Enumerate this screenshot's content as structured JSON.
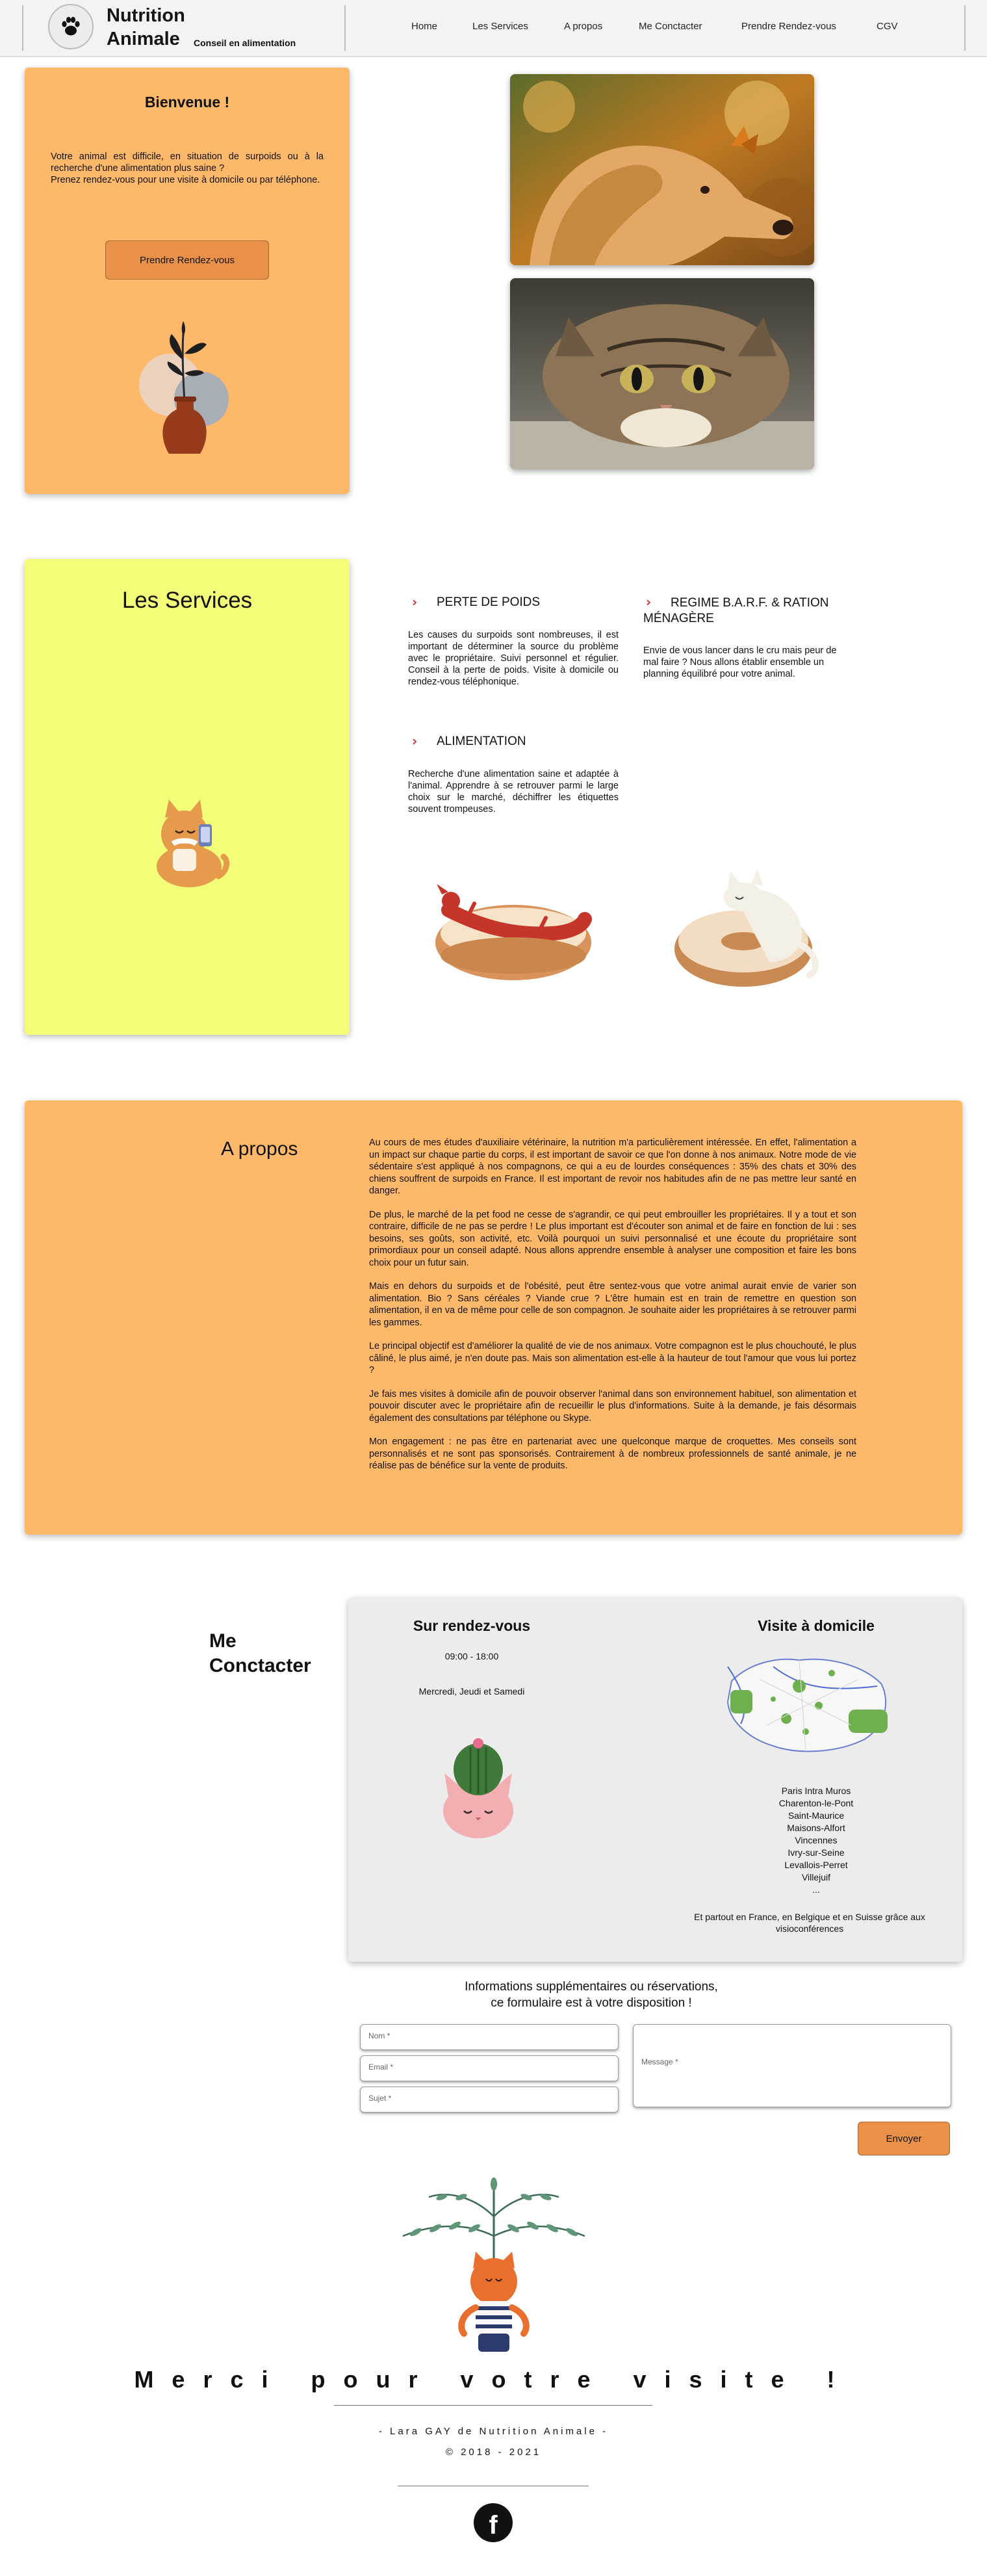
{
  "header": {
    "brand_line1": "Nutrition",
    "brand_line2": "Animale",
    "tagline": "Conseil en alimentation",
    "nav": [
      "Home",
      "Les Services",
      "A propos",
      "Me Conctacter",
      "Prendre Rendez-vous",
      "CGV"
    ]
  },
  "welcome": {
    "title": "Bienvenue !",
    "text": "Votre animal est difficile, en situation de surpoids ou à la recherche d'une alimentation plus saine ?\nPrenez rendez-vous pour une visite à domicile ou par téléphone.",
    "button": "Prendre Rendez-vous"
  },
  "services": {
    "title": "Les Services",
    "items": [
      {
        "title": "PERTE DE POIDS",
        "text": "Les causes du surpoids sont nombreuses, il est important de déterminer la source du problème avec le propriétaire. Suivi personnel et régulier. Conseil à la perte de poids. Visite à domicile ou rendez-vous téléphonique."
      },
      {
        "title": "REGIME B.A.R.F. & RATION MÉNAGÈRE",
        "text": "Envie de vous lancer dans le cru mais peur de mal faire ? Nous allons établir ensemble un planning équilibré pour votre animal."
      },
      {
        "title": "ALIMENTATION",
        "text": "Recherche d'une alimentation saine et adaptée à l'animal. Apprendre à se retrouver parmi le large choix sur le marché, déchiffrer les étiquettes souvent trompeuses."
      }
    ]
  },
  "apropos": {
    "title": "A propos",
    "paragraphs": [
      "Au cours de mes études d'auxiliaire vétérinaire, la nutrition m'a particulièrement intéressée. En effet, l'alimentation a un impact sur chaque partie du corps, il est important de savoir ce que l'on donne à nos animaux. Notre mode de vie sédentaire s'est appliqué à nos compagnons, ce qui a eu de lourdes conséquences : 35% des chats et 30% des chiens souffrent de surpoids en France. Il est important de revoir nos habitudes afin de ne pas mettre leur santé en danger.",
      "De plus, le marché de la pet food ne cesse de s'agrandir, ce qui peut embrouiller les propriétaires. Il y a tout et son contraire, difficile de ne pas se perdre ! Le plus important est d'écouter son animal et de faire en fonction de lui : ses besoins, ses goûts, son activité, etc. Voilà pourquoi un suivi personnalisé et une écoute du propriétaire sont primordiaux pour un conseil adapté. Nous allons apprendre ensemble à analyser une composition et faire les bons choix pour un futur sain.",
      "Mais en dehors du surpoids et de l'obésité, peut être sentez-vous que votre animal aurait envie de varier son alimentation. Bio ? Sans céréales ? Viande crue ? L'être humain est en train de remettre en question son alimentation, il en va de même pour celle de son compagnon. Je souhaite aider les propriétaires à se retrouver parmi les gammes.",
      "Le principal objectif est d'améliorer la qualité de vie de nos animaux. Votre compagnon est le plus chouchouté, le plus câliné, le plus aimé, je n'en doute pas. Mais son alimentation est-elle à la hauteur de tout l'amour que vous lui portez ?",
      "Je fais mes visites à domicile afin de pouvoir observer l'animal dans son environnement habituel, son alimentation et pouvoir discuter avec le propriétaire afin de recueillir le plus d'informations. Suite à la demande, je fais désormais également des consultations par téléphone ou Skype.",
      "Mon engagement : ne pas être en partenariat avec une quelconque marque de croquettes. Mes conseils sont personnalisés et ne sont pas sponsorisés. Contrairement à de nombreux professionnels de santé animale, je ne réalise pas de bénéfice sur la vente de produits."
    ]
  },
  "contact": {
    "title_line1": "Me",
    "title_line2": "Conctacter",
    "rdv_title": "Sur rendez-vous",
    "hours": "09:00 - 18:00",
    "days": "Mercredi, Jeudi et Samedi",
    "visit_title": "Visite à domicile",
    "cities": [
      "Paris Intra Muros",
      "Charenton-le-Pont",
      "Saint-Maurice",
      "Maisons-Alfort",
      "Vincennes",
      "Ivry-sur-Seine",
      "Levallois-Perret",
      "Villejuif",
      "..."
    ],
    "remote": "Et partout en France, en Belgique et en Suisse grâce aux visioconférences",
    "form_intro_line1": "Informations supplémentaires ou réservations,",
    "form_intro_line2": "ce formulaire est à votre disposition !",
    "name_placeholder": "Nom *",
    "email_placeholder": "Email *",
    "subject_placeholder": "Sujet *",
    "message_placeholder": "Message *",
    "send": "Envoyer"
  },
  "footer": {
    "thanks": "Merci pour votre visite !",
    "author": "- Lara GAY de Nutrition Animale -",
    "copyright": "© 2018 - 2021",
    "social": "f"
  },
  "colors": {
    "orange": "#fdb86a",
    "yellow": "#f3fd78",
    "accent_red": "#c8323a",
    "button": "#e99149"
  }
}
